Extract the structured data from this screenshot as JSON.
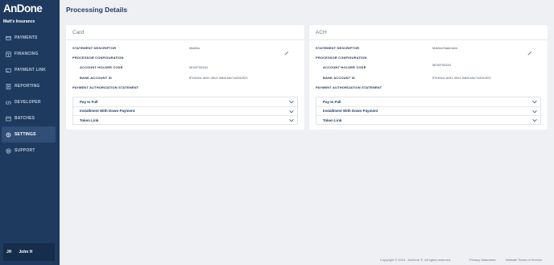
{
  "app": {
    "logo": "AnDone",
    "org_name": "Matt's Insurance"
  },
  "sidebar": {
    "items": [
      {
        "label": "PAYMENTS",
        "icon": "payments-icon"
      },
      {
        "label": "FINANCING",
        "icon": "financing-icon"
      },
      {
        "label": "PAYMENT LINK",
        "icon": "payment-link-icon"
      },
      {
        "label": "REPORTING",
        "icon": "reporting-icon"
      },
      {
        "label": "DEVELOPER",
        "icon": "developer-icon"
      },
      {
        "label": "BATCHES",
        "icon": "batches-icon"
      },
      {
        "label": "SETTINGS",
        "icon": "settings-icon",
        "active": true
      },
      {
        "label": "SUPPORT",
        "icon": "support-icon"
      }
    ],
    "user": {
      "initials": "JH",
      "name": "John H"
    }
  },
  "page": {
    "title": "Processing Details"
  },
  "labels": {
    "statement_descriptor": "STATEMENT DESCRIPTOR",
    "processor_configuration": "PROCESSOR CONFIGURATION",
    "account_holder_code": "ACCOUNT HOLDER CODE",
    "bank_account_id": "BANK ACCOUNT ID",
    "payment_authorization_statement": "PAYMENT AUTHORIZATION STATEMENT"
  },
  "cards": [
    {
      "title": "Card",
      "statement_descriptor": "MattIns",
      "account_holder_code": "MOKP33344",
      "bank_account_id": "ff7e62e4-dc51-49c4-9db8-b8c7a3342f23",
      "authorizations": [
        "Pay In Full",
        "Installment With Down Payment",
        "Token Link"
      ]
    },
    {
      "title": "ACH",
      "statement_descriptor": "MattInsStatement",
      "account_holder_code": "MOKP33344",
      "bank_account_id": "ff7e62e4-dc51-49c4-9db8-b8c7a3342f23",
      "authorizations": [
        "Pay In Full",
        "Installment With Down Payment",
        "Token Link"
      ]
    }
  ],
  "footer": {
    "copyright": "Copyright © 2024 - AnDone ®. All rights reserved.",
    "privacy": "Privacy Statement",
    "terms": "Website Terms of Service"
  },
  "colors": {
    "sidebar": "#1e3a5f",
    "active": "#314e76",
    "background": "#eef0f4",
    "accent_text": "#1f3b63"
  }
}
